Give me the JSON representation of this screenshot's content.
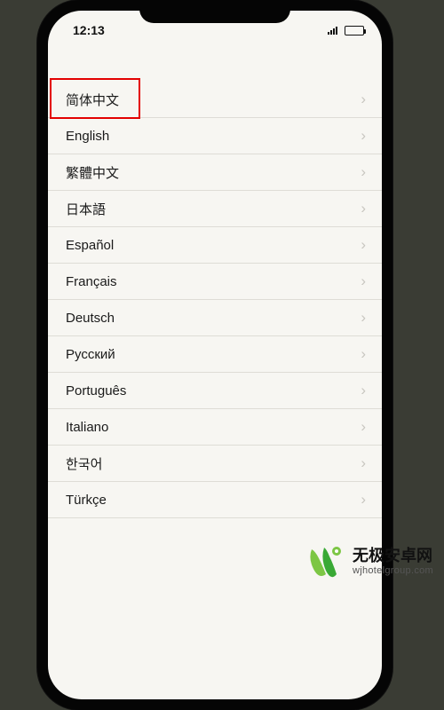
{
  "status": {
    "time": "12:13"
  },
  "languages": {
    "items": [
      {
        "label": "简体中文"
      },
      {
        "label": "English"
      },
      {
        "label": "繁體中文"
      },
      {
        "label": "日本語"
      },
      {
        "label": "Español"
      },
      {
        "label": "Français"
      },
      {
        "label": "Deutsch"
      },
      {
        "label": "Русский"
      },
      {
        "label": "Português"
      },
      {
        "label": "Italiano"
      },
      {
        "label": "한국어"
      },
      {
        "label": "Türkçe"
      }
    ]
  },
  "watermark": {
    "title": "无极安卓网",
    "url": "wjhotelgroup.com"
  }
}
